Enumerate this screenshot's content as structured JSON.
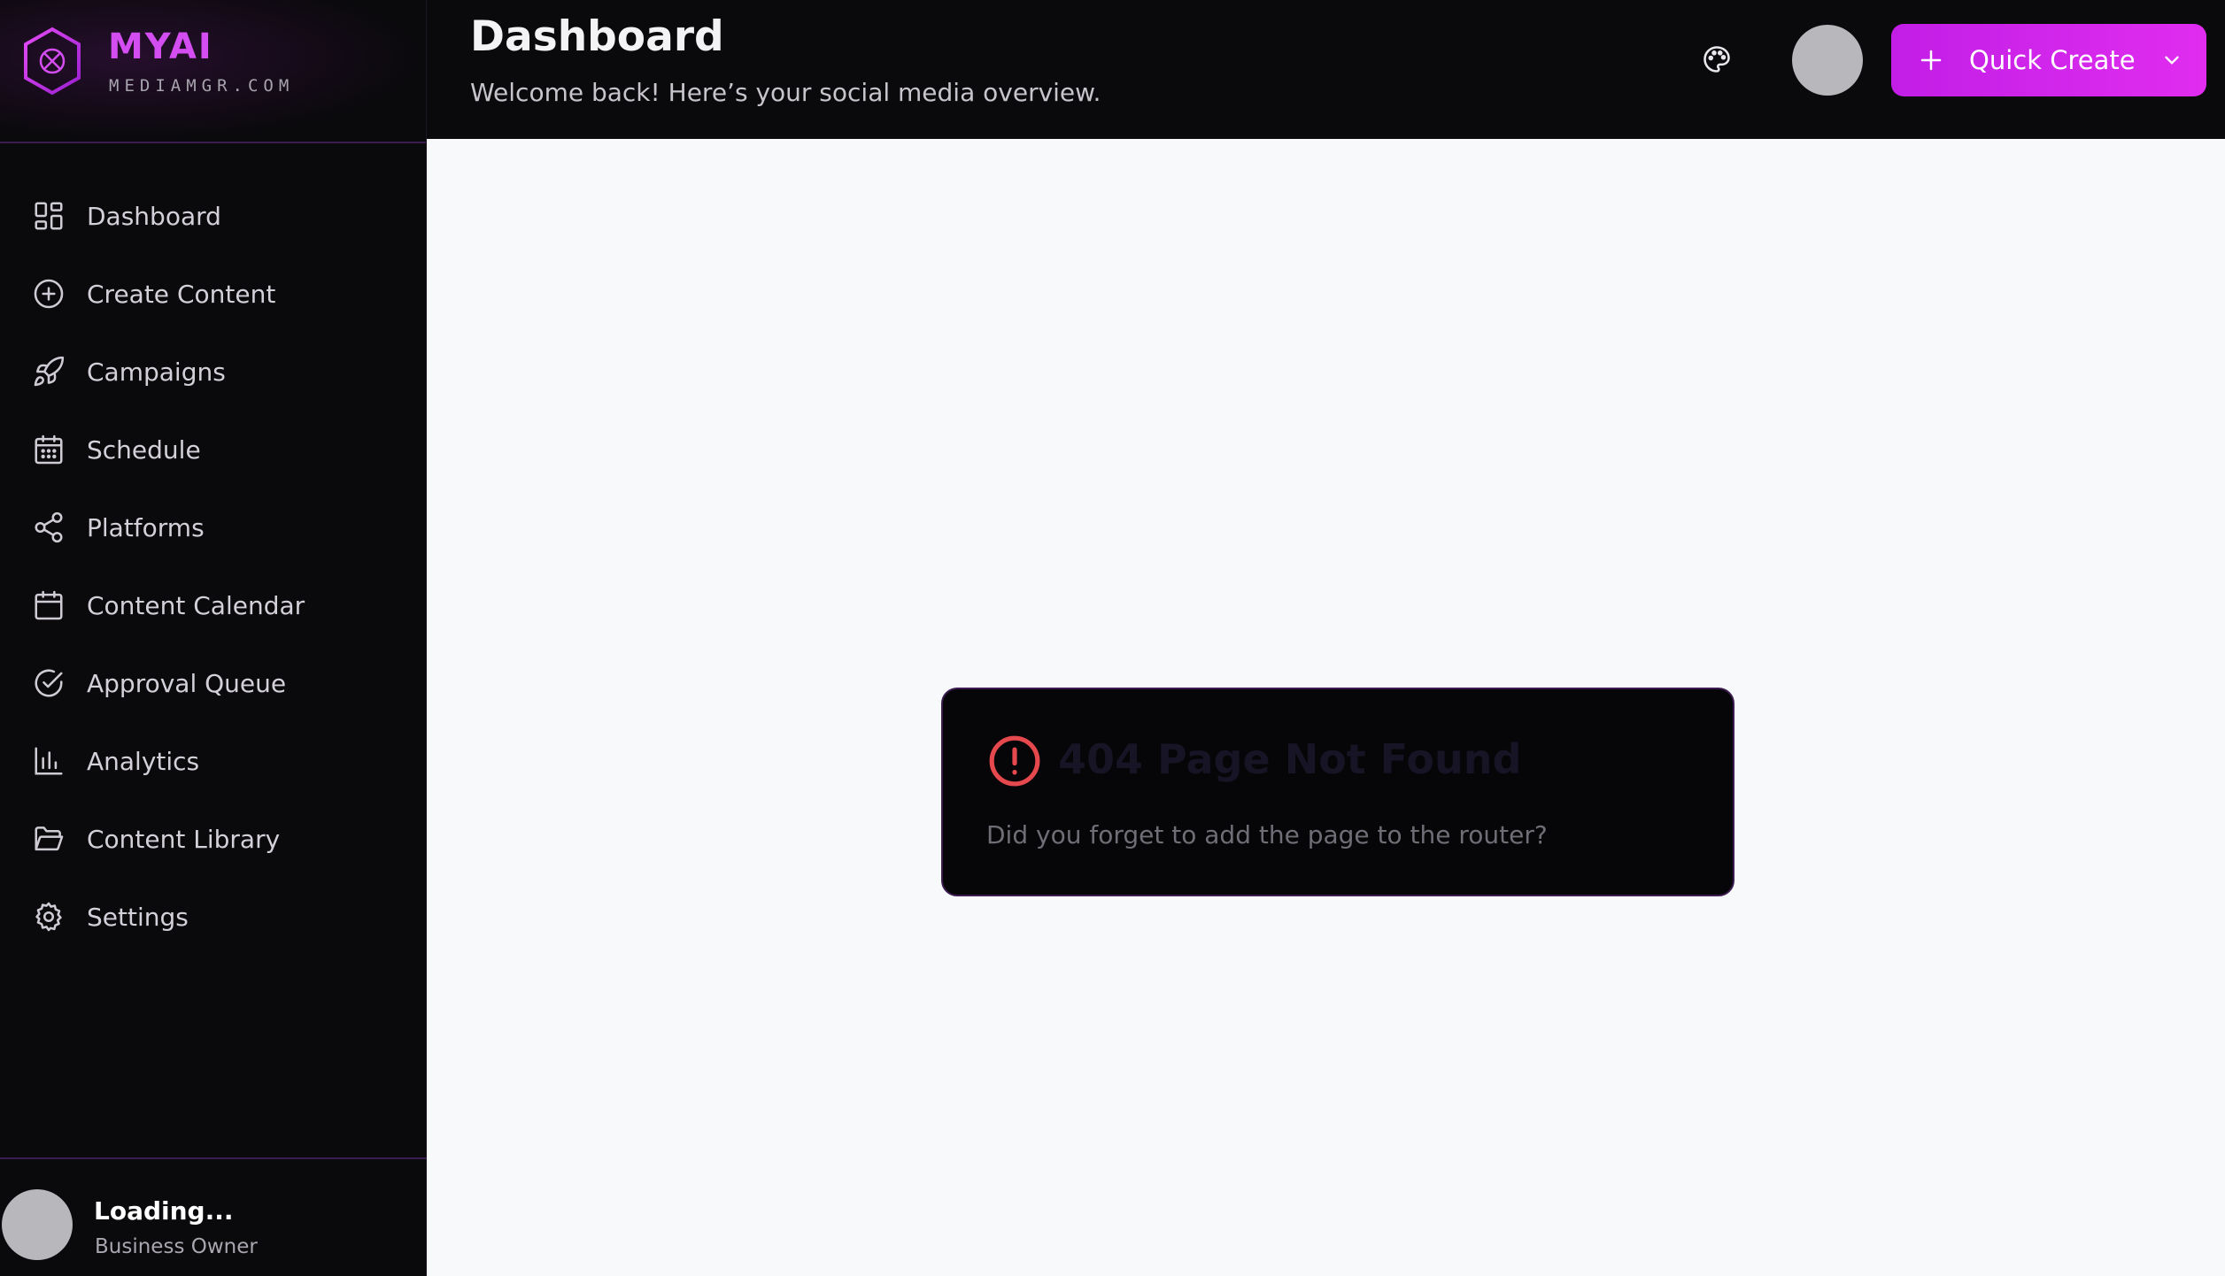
{
  "brand": {
    "name": "MYAI",
    "domain": "MEDIAMGR.COM",
    "accent_color": "#d44df0"
  },
  "sidebar": {
    "items": [
      {
        "label": "Dashboard",
        "icon": "grid-icon"
      },
      {
        "label": "Create Content",
        "icon": "plus-circle-icon"
      },
      {
        "label": "Campaigns",
        "icon": "rocket-icon"
      },
      {
        "label": "Schedule",
        "icon": "calendar-dots-icon"
      },
      {
        "label": "Platforms",
        "icon": "share-icon"
      },
      {
        "label": "Content Calendar",
        "icon": "calendar-icon"
      },
      {
        "label": "Approval Queue",
        "icon": "check-circle-icon"
      },
      {
        "label": "Analytics",
        "icon": "bar-chart-icon"
      },
      {
        "label": "Content Library",
        "icon": "folder-open-icon"
      },
      {
        "label": "Settings",
        "icon": "gear-icon"
      }
    ]
  },
  "user": {
    "name": "Loading...",
    "role": "Business Owner"
  },
  "header": {
    "title": "Dashboard",
    "subtitle": "Welcome back! Here’s your social media overview.",
    "icons": [
      "palette-icon",
      "bell-icon"
    ],
    "quick_create_label": "Quick Create",
    "quick_create_color": "#d225ec"
  },
  "error_card": {
    "title": "404 Page Not Found",
    "message": "Did you forget to add the page to the router?",
    "icon": "alert-circle-icon",
    "icon_color": "#e5484d"
  }
}
